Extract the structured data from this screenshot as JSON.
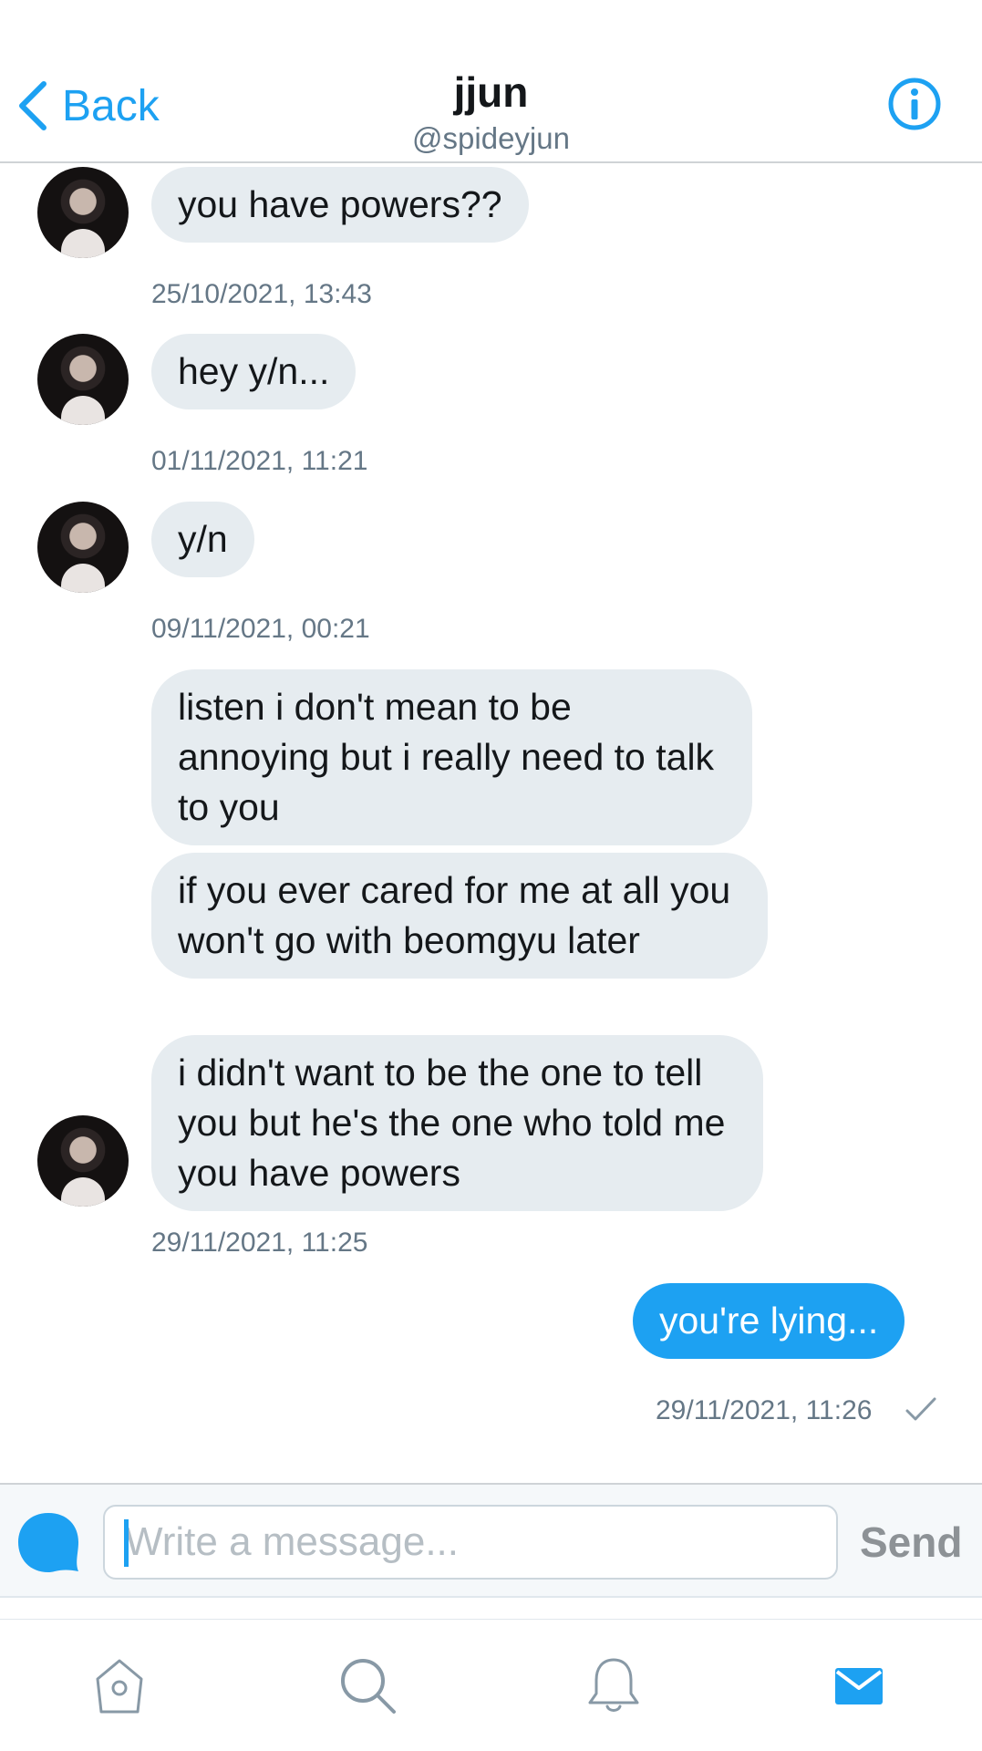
{
  "header": {
    "back_label": "Back",
    "title": "jjun",
    "handle": "@spideyjun"
  },
  "messages": [
    {
      "text": "you have powers??",
      "timestamp": "25/10/2021, 13:43"
    },
    {
      "text": "hey y/n...",
      "timestamp": "01/11/2021, 11:21"
    },
    {
      "text": "y/n",
      "timestamp": "09/11/2021, 00:21"
    },
    {
      "text": "listen i don't mean to be annoying but i really need to talk to you"
    },
    {
      "text": "if you ever cared for me at all you won't go with beomgyu later"
    },
    {
      "text": "i didn't want to be the one to tell you but he's the one who told me you have powers",
      "timestamp": "29/11/2021, 11:25"
    },
    {
      "text": "you're lying...",
      "timestamp": "29/11/2021, 11:26",
      "outgoing": true
    }
  ],
  "composer": {
    "placeholder": "Write a message...",
    "send_label": "Send"
  },
  "tabbar": {
    "items": [
      "home-icon",
      "search-icon",
      "bell-icon",
      "mail-icon"
    ],
    "active": "mail-icon"
  },
  "colors": {
    "accent": "#1da1f2",
    "bubble_in": "#e6ecf0",
    "muted": "#657786"
  }
}
